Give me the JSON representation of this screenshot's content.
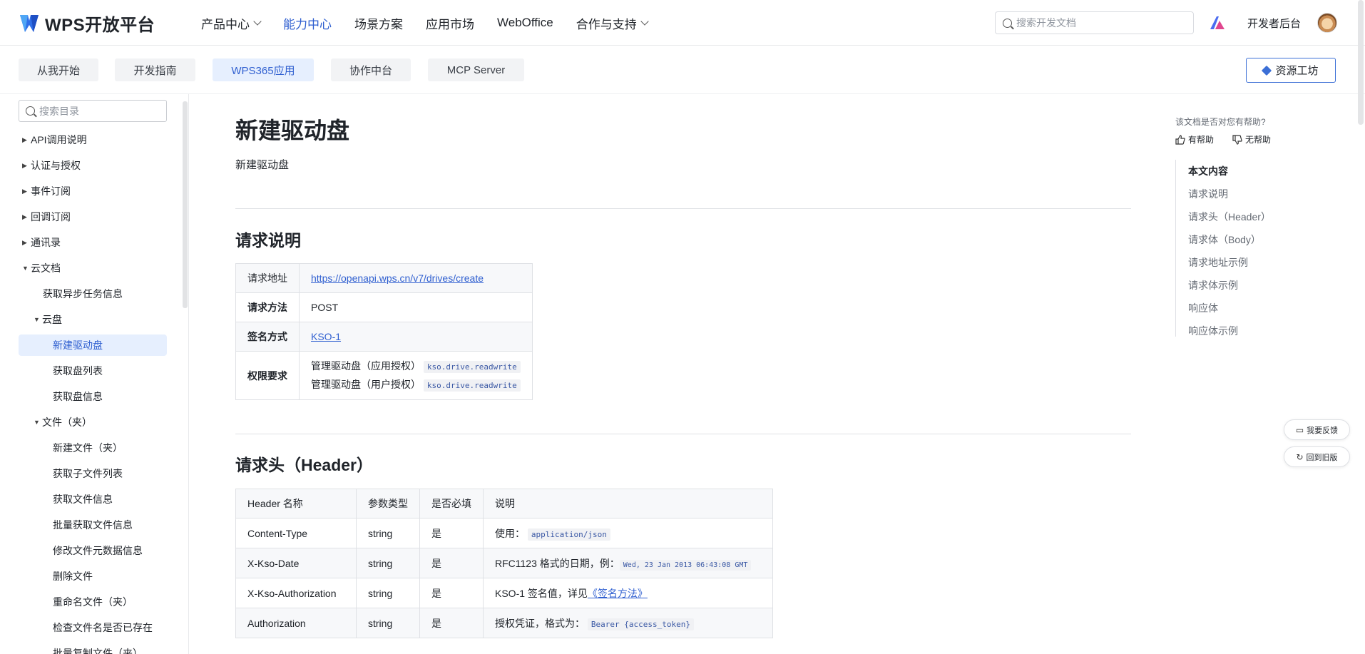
{
  "header": {
    "logo_text": "WPS开放平台",
    "nav": [
      {
        "label": "产品中心",
        "dropdown": true
      },
      {
        "label": "能力中心",
        "active": true
      },
      {
        "label": "场景方案"
      },
      {
        "label": "应用市场"
      },
      {
        "label": "WebOffice"
      },
      {
        "label": "合作与支持",
        "dropdown": true
      }
    ],
    "search_placeholder": "搜索开发文档",
    "dev_console": "开发者后台"
  },
  "subnav": {
    "tabs": [
      "从我开始",
      "开发指南",
      "WPS365应用",
      "协作中台",
      "MCP Server"
    ],
    "active_index": 2,
    "resource_button": "资源工坊"
  },
  "sidebar": {
    "search_placeholder": "搜索目录",
    "items": [
      {
        "label": "API调用说明",
        "arrow": "▶"
      },
      {
        "label": "认证与授权",
        "arrow": "▶"
      },
      {
        "label": "事件订阅",
        "arrow": "▶"
      },
      {
        "label": "回调订阅",
        "arrow": "▶"
      },
      {
        "label": "通讯录",
        "arrow": "▶"
      },
      {
        "label": "云文档",
        "arrow": "▼"
      },
      {
        "label": "获取异步任务信息"
      },
      {
        "label": "云盘",
        "arrow": "▼"
      },
      {
        "label": "新建驱动盘",
        "active": true
      },
      {
        "label": "获取盘列表"
      },
      {
        "label": "获取盘信息"
      },
      {
        "label": "文件（夹）",
        "arrow": "▼"
      },
      {
        "label": "新建文件（夹）"
      },
      {
        "label": "获取子文件列表"
      },
      {
        "label": "获取文件信息"
      },
      {
        "label": "批量获取文件信息"
      },
      {
        "label": "修改文件元数据信息"
      },
      {
        "label": "删除文件"
      },
      {
        "label": "重命名文件（夹）"
      },
      {
        "label": "检查文件名是否已存在"
      },
      {
        "label": "批量复制文件（夹）"
      }
    ]
  },
  "main": {
    "title": "新建驱动盘",
    "description": "新建驱动盘",
    "request": {
      "heading": "请求说明",
      "rows": {
        "url_label": "请求地址",
        "url": "https://openapi.wps.cn/v7/drives/create",
        "method_label": "请求方法",
        "method": "POST",
        "sign_label": "签名方式",
        "sign": "KSO-1",
        "perm_label": "权限要求",
        "perm1_text": "管理驱动盘（应用授权）",
        "perm1_code": "kso.drive.readwrite",
        "perm2_text": "管理驱动盘（用户授权）",
        "perm2_code": "kso.drive.readwrite"
      }
    },
    "header_section": {
      "heading": "请求头（Header）",
      "columns": [
        "Header 名称",
        "参数类型",
        "是否必填",
        "说明"
      ],
      "rows": [
        {
          "name": "Content-Type",
          "type": "string",
          "required": "是",
          "desc": "使用：",
          "code": "application/json"
        },
        {
          "name": "X-Kso-Date",
          "type": "string",
          "required": "是",
          "desc": "RFC1123 格式的日期，例：",
          "code": "Wed, 23 Jan 2013 06:43:08 GMT"
        },
        {
          "name": "X-Kso-Authorization",
          "type": "string",
          "required": "是",
          "desc": "KSO-1 签名值，详见",
          "link": "《签名方法》"
        },
        {
          "name": "Authorization",
          "type": "string",
          "required": "是",
          "desc": "授权凭证，格式为：",
          "code": "Bearer {access_token}"
        }
      ]
    }
  },
  "right_panel": {
    "question": "该文档是否对您有帮助?",
    "helpful": "有帮助",
    "not_helpful": "无帮助",
    "toc_title": "本文内容",
    "toc": [
      "请求说明",
      "请求头（Header）",
      "请求体（Body）",
      "请求地址示例",
      "请求体示例",
      "响应体",
      "响应体示例"
    ]
  },
  "floating": {
    "feedback": "我要反馈",
    "old_version": "回到旧版"
  },
  "colors": {
    "accent": "#2f5fd0",
    "active_bg": "#e6effe",
    "border": "#dfe1e5"
  }
}
